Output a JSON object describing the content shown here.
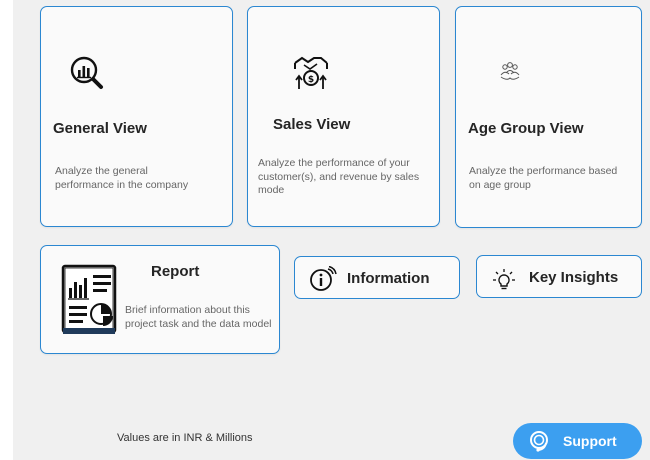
{
  "cards": {
    "general": {
      "title": "General View",
      "description": "Analyze the general performance in the company",
      "icon": "chart-magnifier-icon"
    },
    "sales": {
      "title": "Sales View",
      "description": "Analyze the performance of your customer(s), and revenue by sales mode",
      "icon": "handshake-coin-icon"
    },
    "age_group": {
      "title": "Age Group View",
      "description": "Analyze the performance based on age group",
      "icon": "people-group-icon"
    },
    "report": {
      "title": "Report",
      "description": "Brief information about this project task and the data model",
      "icon": "report-document-icon"
    }
  },
  "buttons": {
    "information": {
      "label": "Information",
      "icon": "info-icon"
    },
    "key_insights": {
      "label": "Key Insights",
      "icon": "lightbulb-icon"
    },
    "support": {
      "label": "Support",
      "icon": "headset-icon"
    }
  },
  "footnote": "Values are in INR & Millions",
  "colors": {
    "border_accent": "#2b87d1",
    "support_button": "#3c9ff0",
    "canvas_background": "#f0f0f0"
  }
}
